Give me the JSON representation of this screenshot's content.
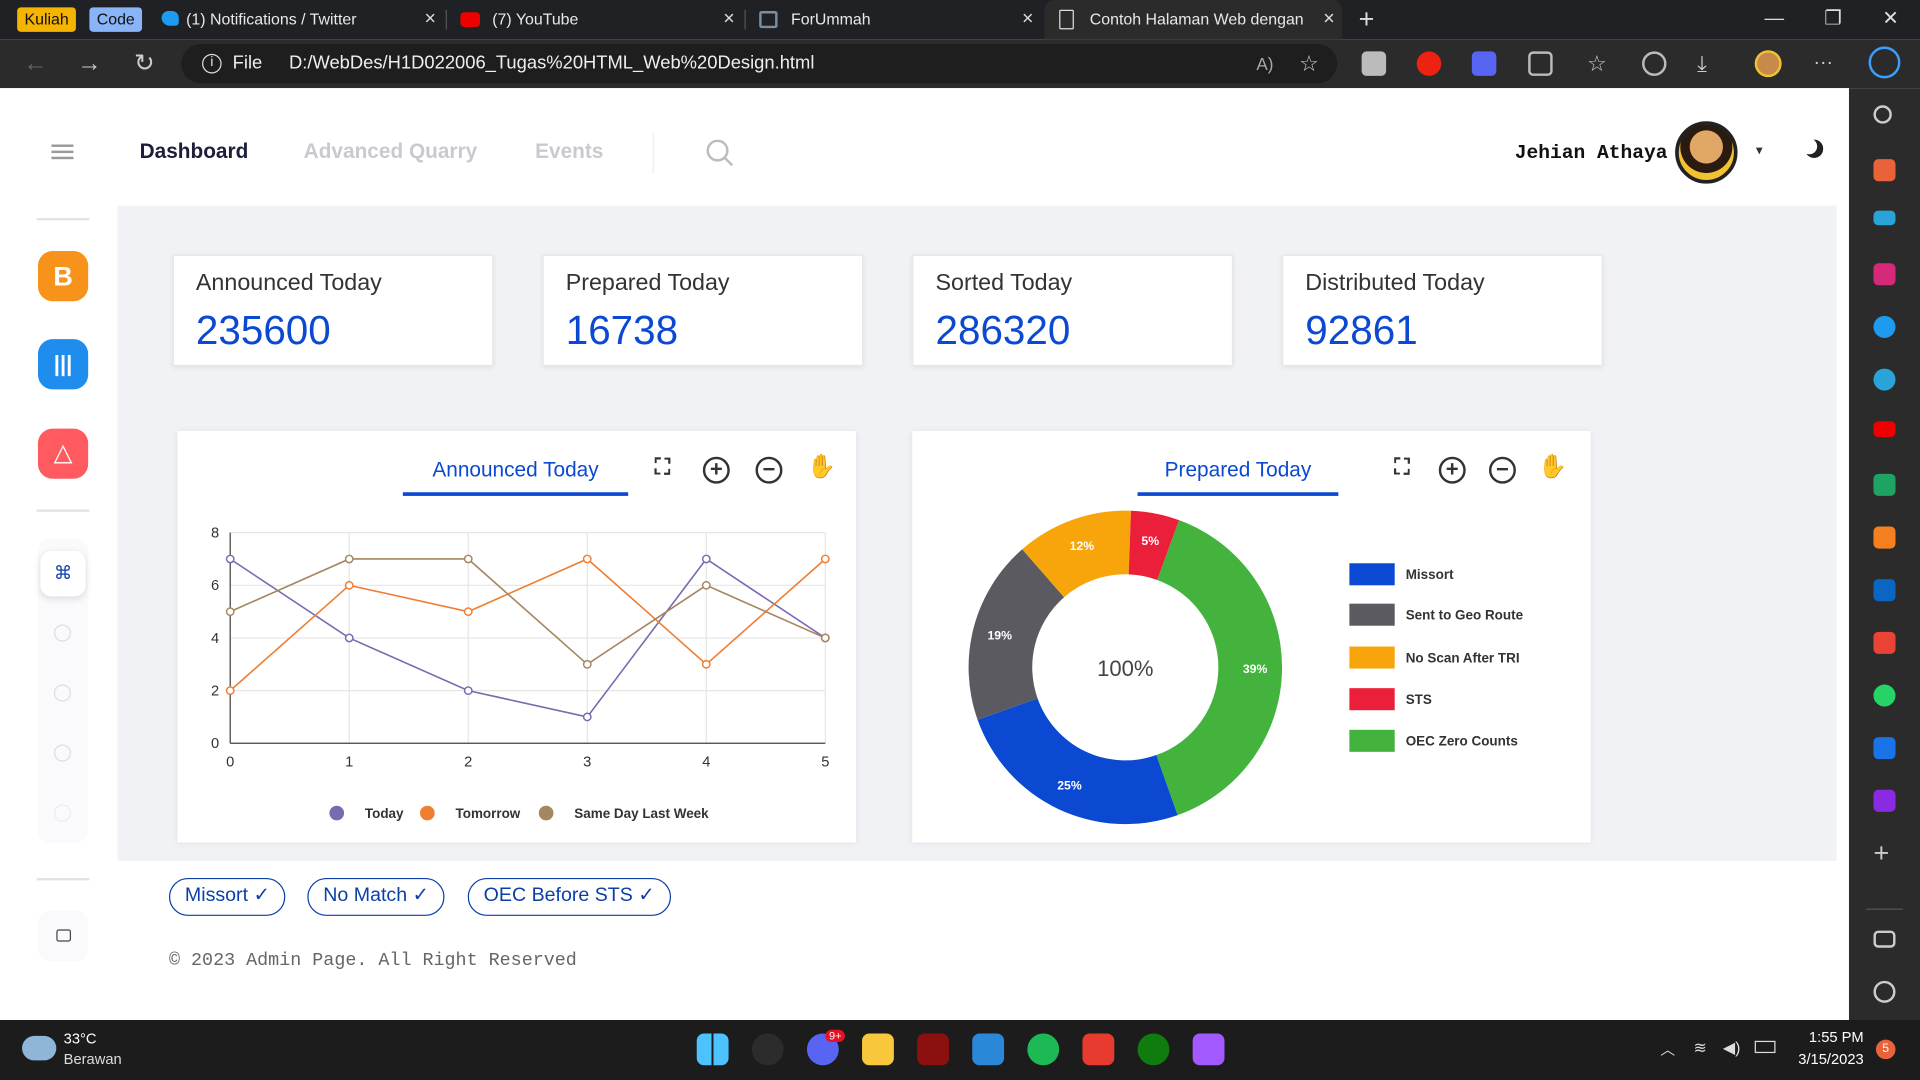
{
  "browser": {
    "tab_groups": [
      {
        "label": "Kuliah",
        "color": "#f4b400"
      },
      {
        "label": "Code",
        "color": "#8ab4f8"
      }
    ],
    "tabs": [
      {
        "label": "(1) Notifications / Twitter"
      },
      {
        "label": "(7) YouTube"
      },
      {
        "label": "ForUmmah"
      },
      {
        "label": "Contoh Halaman Web dengan Ta"
      }
    ],
    "address": {
      "scheme": "File",
      "url": "D:/WebDes/H1D022006_Tugas%20HTML_Web%20Design.html"
    }
  },
  "header": {
    "nav": [
      {
        "label": "Dashboard",
        "active": true
      },
      {
        "label": "Advanced Quarry"
      },
      {
        "label": "Events"
      }
    ],
    "user_name": "Jehian Athaya"
  },
  "stats": [
    {
      "title": "Announced Today",
      "value": "235600"
    },
    {
      "title": "Prepared Today",
      "value": "16738"
    },
    {
      "title": "Sorted Today",
      "value": "286320"
    },
    {
      "title": "Distributed Today",
      "value": "92861"
    }
  ],
  "line_panel": {
    "tab_label": "Announced Today"
  },
  "pie_panel": {
    "tab_label": "Prepared Today",
    "center_label": "100%"
  },
  "chart_data": [
    {
      "type": "line",
      "x": [
        0,
        1,
        2,
        3,
        4,
        5
      ],
      "ylim": [
        0,
        8
      ],
      "yticks": [
        0,
        2,
        4,
        6,
        8
      ],
      "series": [
        {
          "name": "Today",
          "color": "#7a6ab0",
          "values": [
            7,
            4,
            2,
            1,
            7,
            4
          ]
        },
        {
          "name": "Tomorrow",
          "color": "#ef7d32",
          "values": [
            2,
            6,
            5,
            7,
            3,
            7
          ]
        },
        {
          "name": "Same Day Last Week",
          "color": "#a4865f",
          "values": [
            5,
            7,
            7,
            3,
            6,
            4
          ]
        }
      ],
      "legend": "bottom"
    },
    {
      "type": "pie",
      "slices": [
        {
          "label": "Missort",
          "value": 25,
          "text": "25%",
          "color": "#0b49d2"
        },
        {
          "label": "Sent to Geo Route",
          "value": 19,
          "text": "19%",
          "color": "#5a5a60"
        },
        {
          "label": "No Scan After TRI",
          "value": 12,
          "text": "12%",
          "color": "#f8a50c"
        },
        {
          "label": "STS",
          "value": 5,
          "text": "5%",
          "color": "#ec1f3b"
        },
        {
          "label": "OEC Zero Counts",
          "value": 39,
          "text": "39%",
          "color": "#43b33d"
        }
      ],
      "legend": "right"
    }
  ],
  "chips": [
    {
      "label": "Missort"
    },
    {
      "label": "No Match"
    },
    {
      "label": "OEC Before STS"
    }
  ],
  "footer": "© 2023 Admin Page. All Right Reserved",
  "taskbar": {
    "temperature": "33°C",
    "weather": "Berawan",
    "time": "1:55 PM",
    "date": "3/15/2023",
    "discord_badge": "9+",
    "notif_count": "5"
  }
}
